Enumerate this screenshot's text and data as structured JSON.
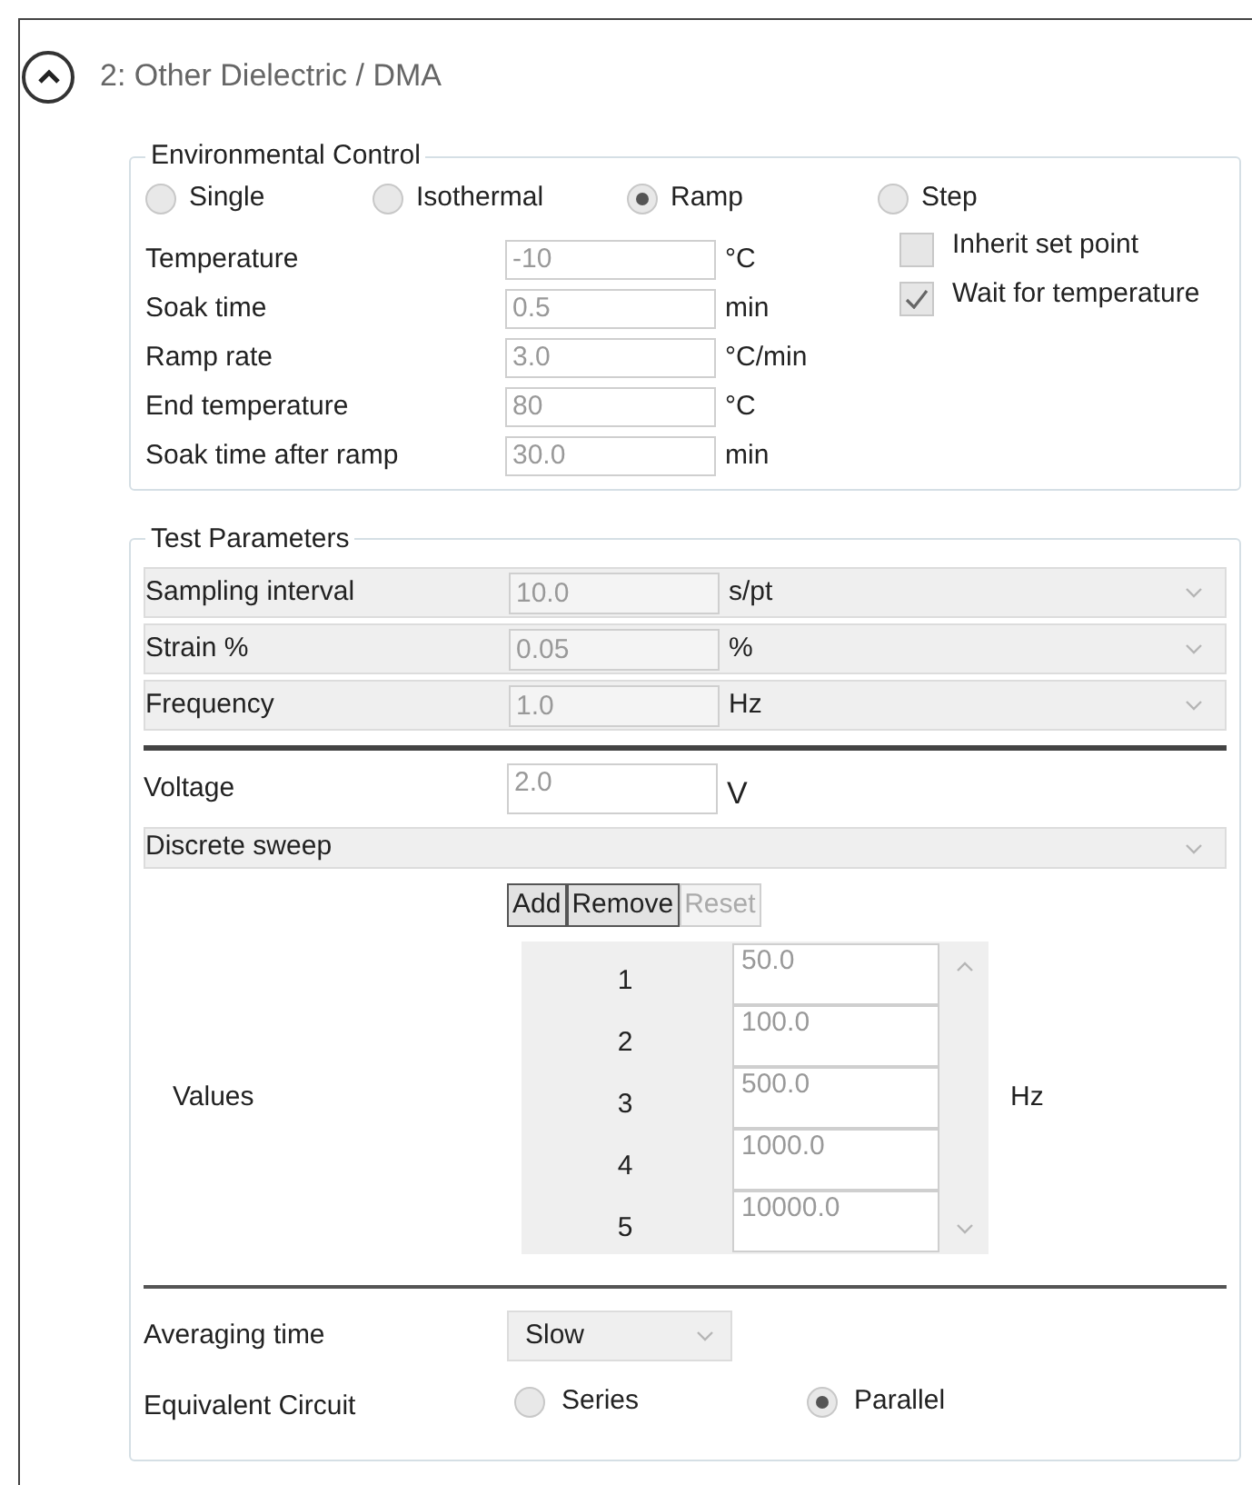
{
  "section": {
    "title": "2: Other Dielectric / DMA",
    "expanded": true
  },
  "environmental_control": {
    "title": "Environmental Control",
    "modes": [
      {
        "label": "Single",
        "selected": false
      },
      {
        "label": "Isothermal",
        "selected": false
      },
      {
        "label": "Ramp",
        "selected": true
      },
      {
        "label": "Step",
        "selected": false
      }
    ],
    "fields": [
      {
        "label": "Temperature",
        "value": "-10",
        "unit": "°C"
      },
      {
        "label": "Soak time",
        "value": "0.5",
        "unit": "min"
      },
      {
        "label": "Ramp rate",
        "value": "3.0",
        "unit": "°C/min"
      },
      {
        "label": "End temperature",
        "value": "80",
        "unit": "°C"
      },
      {
        "label": "Soak time after ramp",
        "value": "30.0",
        "unit": "min"
      }
    ],
    "options": [
      {
        "label": "Inherit set point",
        "checked": false
      },
      {
        "label": "Wait for temperature",
        "checked": true
      }
    ]
  },
  "test_parameters": {
    "title": "Test Parameters",
    "rows": [
      {
        "label": "Sampling interval",
        "value": "10.0",
        "unit": "s/pt"
      },
      {
        "label": "Strain %",
        "value": "0.05",
        "unit": "%"
      },
      {
        "label": "Frequency",
        "value": "1.0",
        "unit": "Hz"
      }
    ],
    "voltage": {
      "label": "Voltage",
      "value": "2.0",
      "unit": "V"
    },
    "sweep_type": "Discrete sweep",
    "buttons": [
      {
        "label": "Add",
        "disabled": false
      },
      {
        "label": "Remove",
        "disabled": false
      },
      {
        "label": "Reset",
        "disabled": true
      }
    ],
    "values": {
      "label": "Values",
      "unit": "Hz",
      "rows": [
        {
          "index": "1",
          "value": "50.0"
        },
        {
          "index": "2",
          "value": "100.0"
        },
        {
          "index": "3",
          "value": "500.0"
        },
        {
          "index": "4",
          "value": "1000.0"
        },
        {
          "index": "5",
          "value": "10000.0"
        }
      ]
    },
    "averaging_time": {
      "label": "Averaging time",
      "value": "Slow"
    },
    "equivalent_circuit": {
      "label": "Equivalent Circuit",
      "options": [
        {
          "label": "Series",
          "selected": false
        },
        {
          "label": "Parallel",
          "selected": true
        }
      ]
    }
  }
}
